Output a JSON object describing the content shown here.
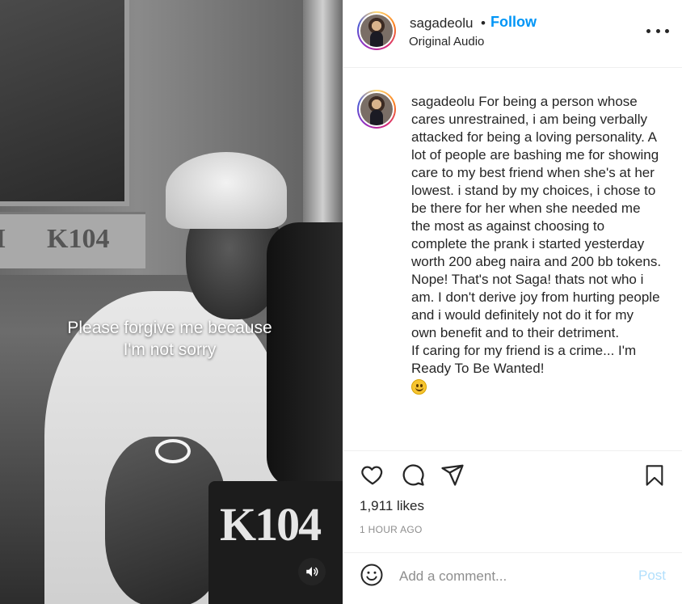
{
  "media": {
    "caption_line1": "Please forgive me because",
    "caption_line2": "I'm not sorry",
    "wall_logo_left": "I",
    "wall_logo": "K104",
    "desk_logo": "K104",
    "audio_icon": "speaker-icon"
  },
  "header": {
    "username": "sagadeolu",
    "separator": "•",
    "follow_label": "Follow",
    "audio_label": "Original Audio",
    "more_icon": "more-options-icon"
  },
  "caption": {
    "username": "sagadeolu",
    "text": "For being a person whose cares unrestrained, i am being verbally attacked for being a loving personality. A lot of people are bashing me for showing care to my best friend when she's at her lowest. i stand by my choices, i chose to be there for her when she needed me the most as against choosing to complete the prank i started yesterday worth 200 abeg naira and 200 bb tokens. Nope! That's not Saga! thats not who i am. I don't derive joy from hurting people and i would definitely not do it for my own benefit and to their detriment.",
    "text2": "If caring for my friend is a crime... I'm Ready To Be Wanted!",
    "emoji": "smiling-face-icon"
  },
  "actions": {
    "like_icon": "heart-icon",
    "comment_icon": "comment-icon",
    "share_icon": "share-icon",
    "save_icon": "bookmark-icon",
    "likes": "1,911 likes",
    "time": "1 HOUR AGO"
  },
  "comment_box": {
    "emoji_icon": "emoji-icon",
    "placeholder": "Add a comment...",
    "post_label": "Post"
  },
  "colors": {
    "accent": "#0095f6",
    "post_disabled": "#b2dffc",
    "text": "#262626",
    "muted": "#8e8e8e"
  }
}
